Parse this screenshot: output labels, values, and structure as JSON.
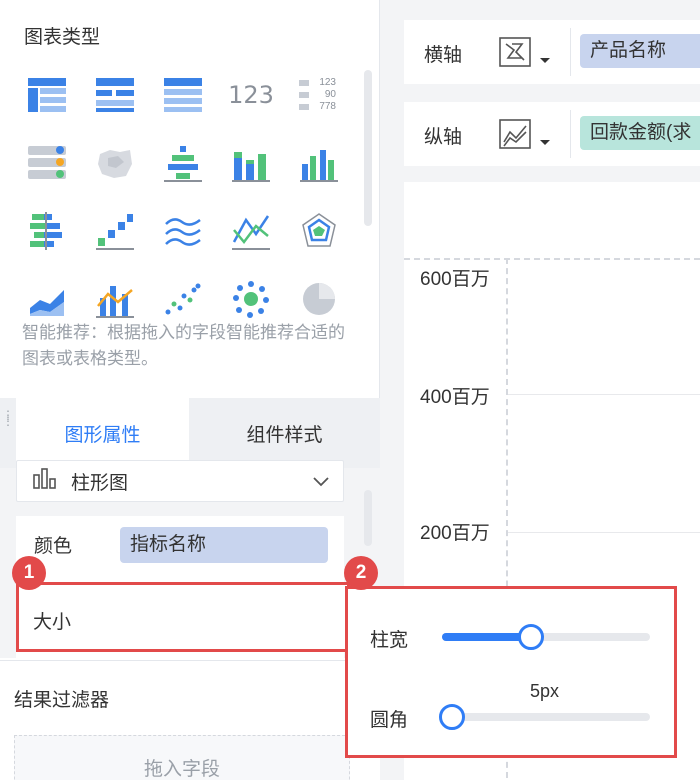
{
  "left": {
    "chart_types_title": "图表类型",
    "hint": "智能推荐：根据拖入的字段智能推荐合适的图表或表格类型。",
    "tabs": {
      "active": "图形属性",
      "inactive": "组件样式"
    },
    "chart_type_select": "柱形图",
    "color_label": "颜色",
    "color_field": "指标名称",
    "size_label": "大小",
    "filter_title": "结果过滤器",
    "drop_hint": "拖入字段",
    "icon_tiles": {
      "number_tile": "123",
      "stack_tile": [
        "123",
        "90",
        "778"
      ]
    }
  },
  "right": {
    "x_axis_label": "横轴",
    "x_axis_field": "产品名称",
    "y_axis_label": "纵轴",
    "y_axis_field": "回款金额(求",
    "y_ticks": [
      "600百万",
      "400百万",
      "200百万"
    ]
  },
  "popup": {
    "bar_width_label": "柱宽",
    "corner_label": "圆角",
    "corner_value": "5px",
    "bar_width_level": 0.43,
    "corner_level": 0.05
  },
  "badges": [
    "1",
    "2"
  ],
  "colors": {
    "accent": "#2f7df6",
    "annotation_red": "#e24a4a",
    "x_chip": "#c8d4ee",
    "y_chip": "#b8e5dc"
  }
}
